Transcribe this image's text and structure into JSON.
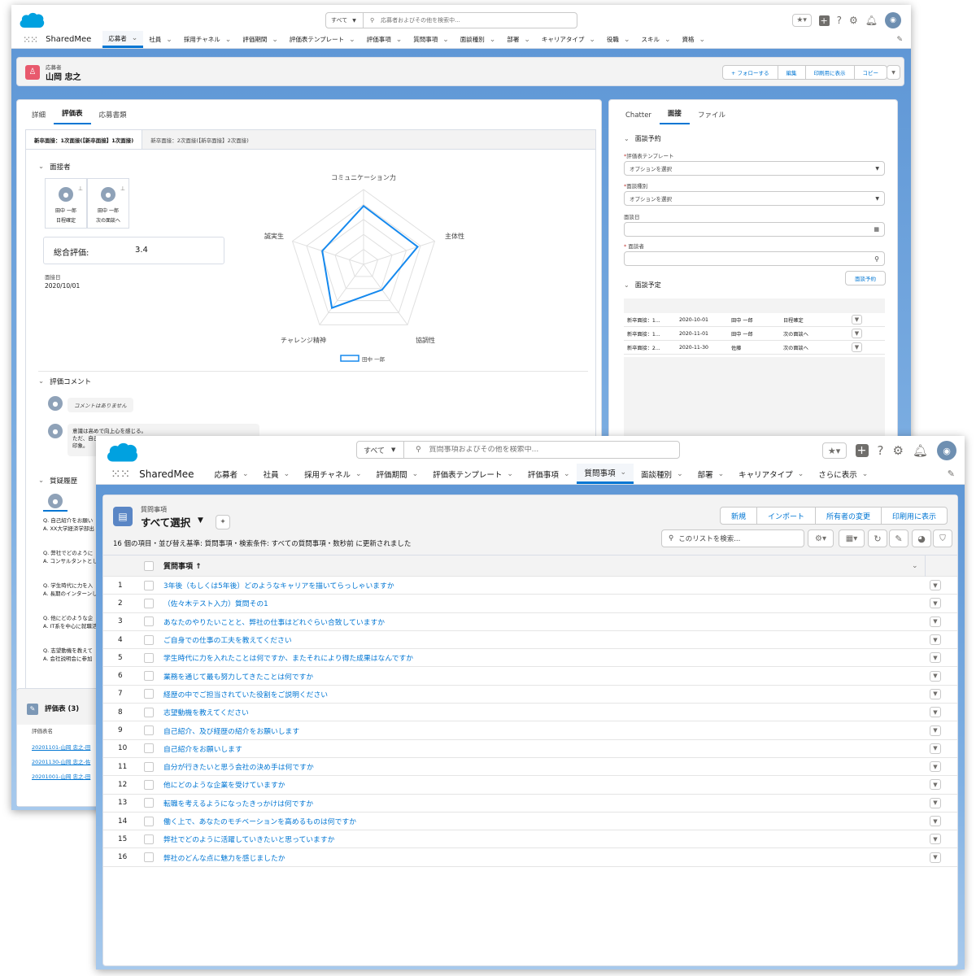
{
  "colors": {
    "brand": "#0176d3",
    "cloud": "#00a1e0",
    "accent_red": "#e8596d",
    "header_blue": "#5f97d6"
  },
  "w1": {
    "search": {
      "scope": "すべて",
      "placeholder": "応募者およびその他を検索中..."
    },
    "app": "SharedMee",
    "nav": [
      "応募者",
      "社員",
      "採用チャネル",
      "評価期間",
      "評価表テンプレート",
      "評価事項",
      "質問事項",
      "面談種別",
      "部署",
      "キャリアタイプ",
      "役職",
      "スキル",
      "資格"
    ],
    "record": {
      "object": "応募者",
      "name": "山岡 忠之",
      "actions": [
        "+ フォローする",
        "編集",
        "印刷用に表示",
        "コピー"
      ]
    },
    "left_tabs": [
      "詳細",
      "評価表",
      "応募書類"
    ],
    "sub_tabs": [
      "新卒面接：1次面接(【新卒面接】1次面接)",
      "新卒面接：2次面接(【新卒面接】2次面接)"
    ],
    "interviewers_title": "面接者",
    "interviewers": [
      {
        "name": "田中 一郎",
        "status": "日程確定"
      },
      {
        "name": "田中 一郎",
        "status": "次の面談へ"
      }
    ],
    "overall_label": "総合評価:",
    "overall_value": "3.4",
    "date_label": "面接日",
    "date_value": "2020/10/01",
    "radar_labels": [
      "コミュニケーション力",
      "主体性",
      "協調性",
      "チャレンジ精神",
      "誠実生"
    ],
    "legend": "田中 一郎",
    "comment_title": "評価コメント",
    "comments": [
      "コメントはありません",
      "意識は高めで向上心を感じる。",
      "ただ、自己",
      "印象。"
    ],
    "qa_title": "質疑履歴",
    "qa": [
      {
        "q": "Q. 自己紹介をお願い",
        "a": "A. XX大学経済学部出"
      },
      {
        "q": "Q. 弊社でどのように",
        "a": "A. コンサルタントとし"
      },
      {
        "q": "Q. 学生時代に力を入",
        "a": "A. 長期のインターンし"
      },
      {
        "q": "Q. 他にどのような企",
        "a": "A. IT系を中心に就職活"
      },
      {
        "q": "Q. 志望動機を教えて",
        "a": "A. 会社説明会に参加"
      }
    ],
    "eval_title": "評価表 (3)",
    "eval_col": "評価表名",
    "eval_rows": [
      "20201101-山岡 忠之-田",
      "20201130-山岡 忠之-佐",
      "20201001-山岡 忠之-田"
    ],
    "right_tabs": [
      "Chatter",
      "面接",
      "ファイル"
    ],
    "booking_title": "面談予約",
    "f_template": "評価表テンプレート",
    "f_template_ph": "オプションを選択",
    "f_kind": "面談種別",
    "f_kind_ph": "オプションを選択",
    "f_date": "面談日",
    "f_person": "面談者",
    "book_btn": "面談予約",
    "schedule_title": "面談予定",
    "schedule": [
      [
        "新卒面接：1...",
        "2020-10-01",
        "田中 一郎",
        "日程確定"
      ],
      [
        "新卒面接：1...",
        "2020-11-01",
        "田中 一郎",
        "次の面談へ"
      ],
      [
        "新卒面接：2...",
        "2020-11-30",
        "佐藤",
        "次の面談へ"
      ]
    ]
  },
  "w2": {
    "search": {
      "scope": "すべて",
      "placeholder": "質問事項およびその他を検索中..."
    },
    "app": "SharedMee",
    "nav": [
      "応募者",
      "社員",
      "採用チャネル",
      "評価期間",
      "評価表テンプレート",
      "評価事項",
      "質問事項",
      "面談種別",
      "部署",
      "キャリアタイプ",
      "さらに表示"
    ],
    "object": "質問事項",
    "view": "すべて選択",
    "actions": [
      "新規",
      "インポート",
      "所有者の変更",
      "印刷用に表示"
    ],
    "meta": "16 個の項目・並び替え基準: 質問事項・検索条件: すべての質問事項・数秒前 に更新されました",
    "list_search": "このリストを検索...",
    "col": "質問事項 ↑",
    "rows": [
      "3年後（もしくは5年後）どのようなキャリアを描いてらっしゃいますか",
      "（佐々木テスト入力）質問その1",
      "あなたのやりたいことと、弊社の仕事はどれぐらい合致していますか",
      "ご自身での仕事の工夫を教えてください",
      "学生時代に力を入れたことは何ですか、またそれにより得た成果はなんですか",
      "業務を通じて最も努力してきたことは何ですか",
      "経歴の中でご担当されていた役割をご説明ください",
      "志望動機を教えてください",
      "自己紹介、及び経歴の紹介をお願いします",
      "自己紹介をお願いします",
      "自分が行きたいと思う会社の決め手は何ですか",
      "他にどのような企業を受けていますか",
      "転職を考えるようになったきっかけは何ですか",
      "働く上で、あなたのモチベーションを高めるものは何ですか",
      "弊社でどのように活躍していきたいと思っていますか",
      "弊社のどんな点に魅力を感じましたか"
    ]
  }
}
